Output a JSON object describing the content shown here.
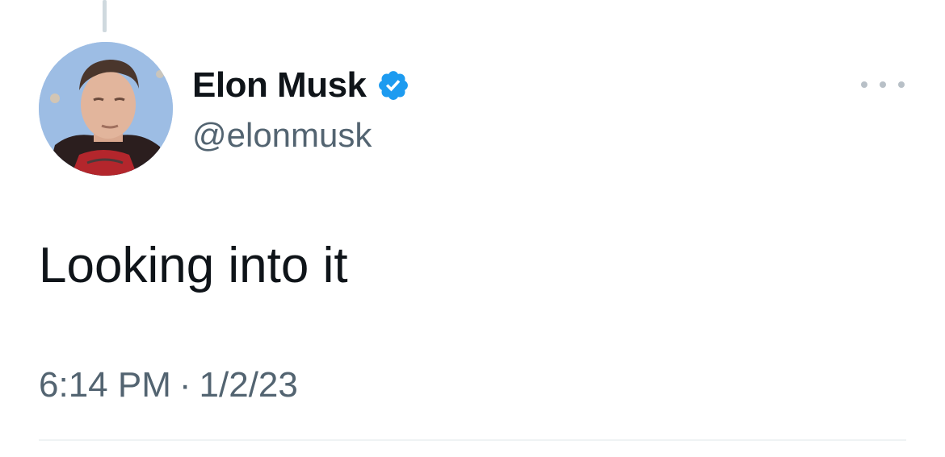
{
  "tweet": {
    "author": {
      "display_name": "Elon Musk",
      "handle": "@elonmusk",
      "verified": true,
      "verified_icon": "verified-badge-icon",
      "verified_color": "#1d9bf0"
    },
    "text": "Looking into it",
    "time": "6:14 PM",
    "separator": "·",
    "date": "1/2/23",
    "more_icon": "more-dots-icon"
  },
  "colors": {
    "text_primary": "#0f1419",
    "text_secondary": "#536471",
    "thread_line": "#cfd9de",
    "divider": "#eff3f4"
  }
}
